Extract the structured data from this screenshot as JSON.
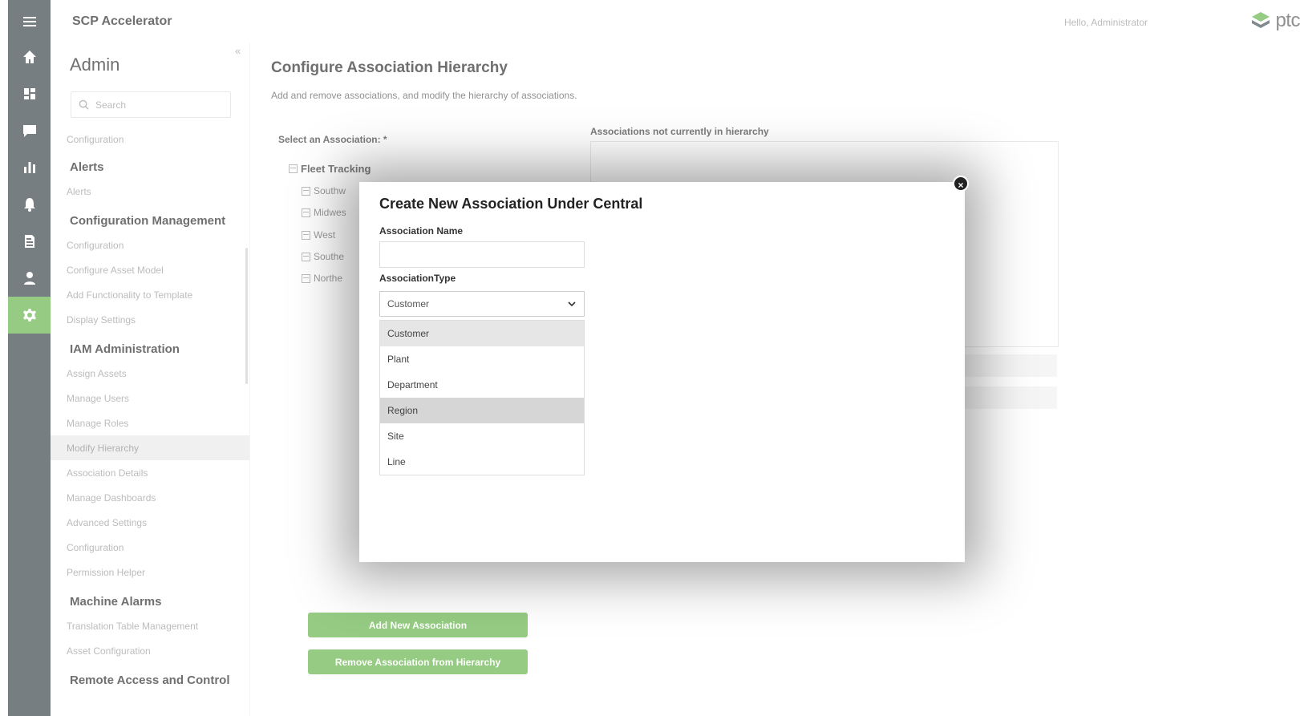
{
  "header": {
    "app_title": "SCP Accelerator",
    "greeting": "Hello, Administrator",
    "logo_text": "ptc"
  },
  "rail": {
    "items": [
      "menu-icon",
      "home-icon",
      "dashboard-icon",
      "chat-icon",
      "chart-icon",
      "bell-icon",
      "document-icon",
      "user-icon",
      "gear-icon"
    ],
    "active": "gear-icon",
    "active_color": "#5cb040"
  },
  "nav": {
    "title": "Admin",
    "collapse": "«",
    "search_placeholder": "Search",
    "top_item": "Configuration",
    "sections": [
      {
        "heading": "Alerts",
        "items": [
          "Alerts"
        ]
      },
      {
        "heading": "Configuration Management",
        "items": [
          "Configuration",
          "Configure Asset Model",
          "Add Functionality to Template",
          "Display Settings"
        ]
      },
      {
        "heading": "IAM Administration",
        "items": [
          "Assign Assets",
          "Manage Users",
          "Manage Roles",
          "Modify Hierarchy",
          "Association Details",
          "Manage Dashboards",
          "Advanced Settings",
          "Configuration",
          "Permission Helper"
        ]
      },
      {
        "heading": "Machine Alarms",
        "items": [
          "Translation Table Management",
          "Asset Configuration"
        ]
      },
      {
        "heading": "Remote Access and Control",
        "items": []
      }
    ],
    "active_item": "Modify Hierarchy"
  },
  "main": {
    "title": "Configure Association Hierarchy",
    "description": "Add and remove associations, and modify the hierarchy of associations.",
    "select_label": "Select an Association: *",
    "not_in_hierarchy_label": "Associations not currently in hierarchy",
    "tree": {
      "root": "Fleet Tracking",
      "children": [
        "Southw",
        "Midwes",
        "West",
        "Southe",
        "Northe"
      ]
    },
    "buttons": {
      "add": "Add New Association",
      "remove": "Remove Association from Hierarchy"
    }
  },
  "modal": {
    "title": "Create New Association Under Central",
    "name_label": "Association Name",
    "name_value": "",
    "type_label": "AssociationType",
    "type_value": "Customer",
    "options": [
      "Customer",
      "Plant",
      "Department",
      "Region",
      "Site",
      "Line"
    ],
    "selected_option": "Customer",
    "hovered_option": "Region",
    "close": "×"
  }
}
